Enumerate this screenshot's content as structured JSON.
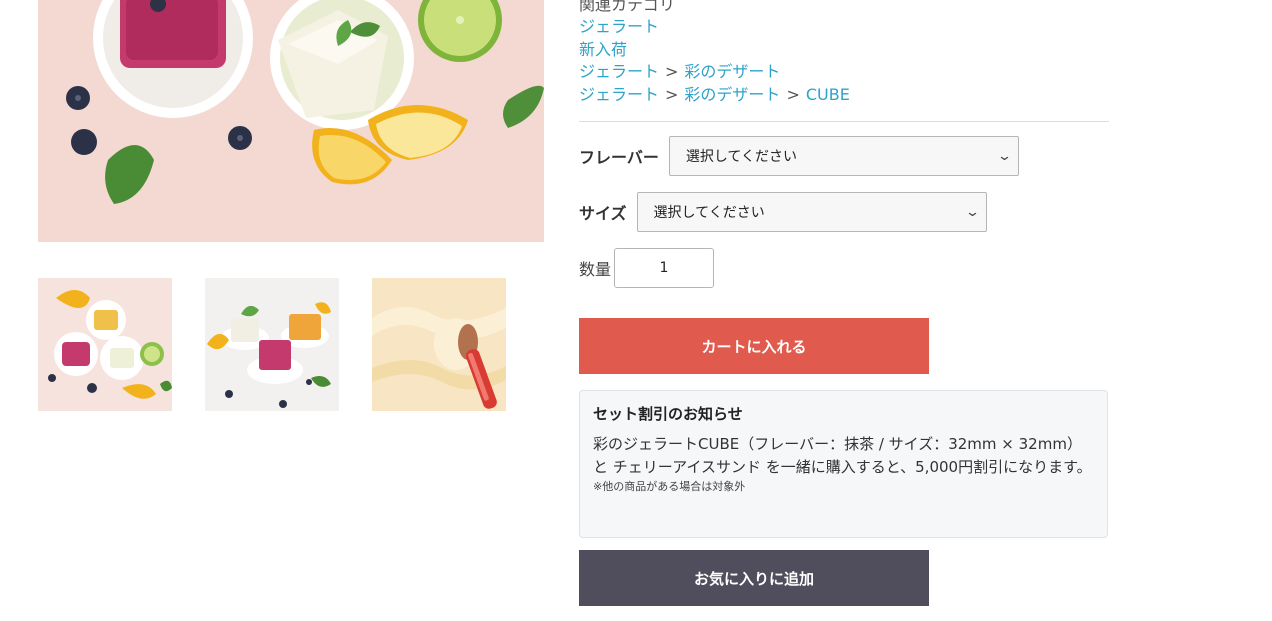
{
  "images": {
    "main_alt": "Gelato cubes with lemon, lime and blueberries",
    "thumbnails": [
      {
        "name": "thumb-cups-overhead"
      },
      {
        "name": "thumb-cups-side"
      },
      {
        "name": "thumb-scoop"
      }
    ]
  },
  "categories": {
    "heading": "関連カテゴリ",
    "separator": ">",
    "rows": [
      [
        "ジェラート"
      ],
      [
        "新入荷"
      ],
      [
        "ジェラート",
        "彩のデザート"
      ],
      [
        "ジェラート",
        "彩のデザート",
        "CUBE"
      ]
    ]
  },
  "options": {
    "flavor_label": "フレーバー",
    "flavor_selected": "選択してください",
    "size_label": "サイズ",
    "size_selected": "選択してください",
    "quantity_label": "数量",
    "quantity_value": "1"
  },
  "buttons": {
    "cart": "カートに入れる",
    "favorite": "お気に入りに追加"
  },
  "notice": {
    "title": "セット割引のお知らせ",
    "body": "彩のジェラートCUBE（フレーバー：抹茶 / サイズ：32mm × 32mm） と チェリーアイスサンド を一緒に購入すると、5,000円割引になります。",
    "note": "※他の商品がある場合は対象外"
  },
  "colors": {
    "link": "#2ca3c9",
    "cart_button": "#e05a4d",
    "favorite_button": "#504e5d",
    "notice_bg": "#f6f7f9"
  },
  "icons": {
    "select_arrow": "chevron-down-icon"
  }
}
